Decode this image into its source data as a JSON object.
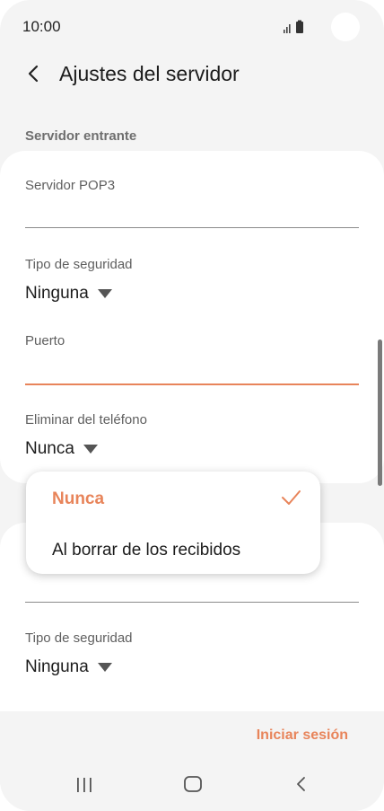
{
  "status_bar": {
    "time": "10:00",
    "icons": [
      "signal-icon",
      "battery-icon"
    ]
  },
  "header": {
    "title": "Ajustes del servidor",
    "back_icon": "chevron-left-icon"
  },
  "incoming": {
    "section_label": "Servidor entrante",
    "pop3_label": "Servidor POP3",
    "pop3_value": "",
    "security_label": "Tipo de seguridad",
    "security_value": "Ninguna",
    "port_label": "Puerto",
    "port_value": "",
    "delete_label": "Eliminar del teléfono",
    "delete_value": "Nunca"
  },
  "dropdown": {
    "options": [
      "Nunca",
      "Al borrar de los recibidos"
    ],
    "selected": "Nunca"
  },
  "outgoing": {
    "security_label": "Tipo de seguridad",
    "security_value": "Ninguna"
  },
  "footer": {
    "login_label": "Iniciar sesión"
  },
  "nav": {
    "icons": [
      "recent-apps-icon",
      "home-icon",
      "back-icon"
    ]
  },
  "colors": {
    "accent": "#e8845a",
    "background": "#f4f4f4",
    "card": "#ffffff"
  }
}
